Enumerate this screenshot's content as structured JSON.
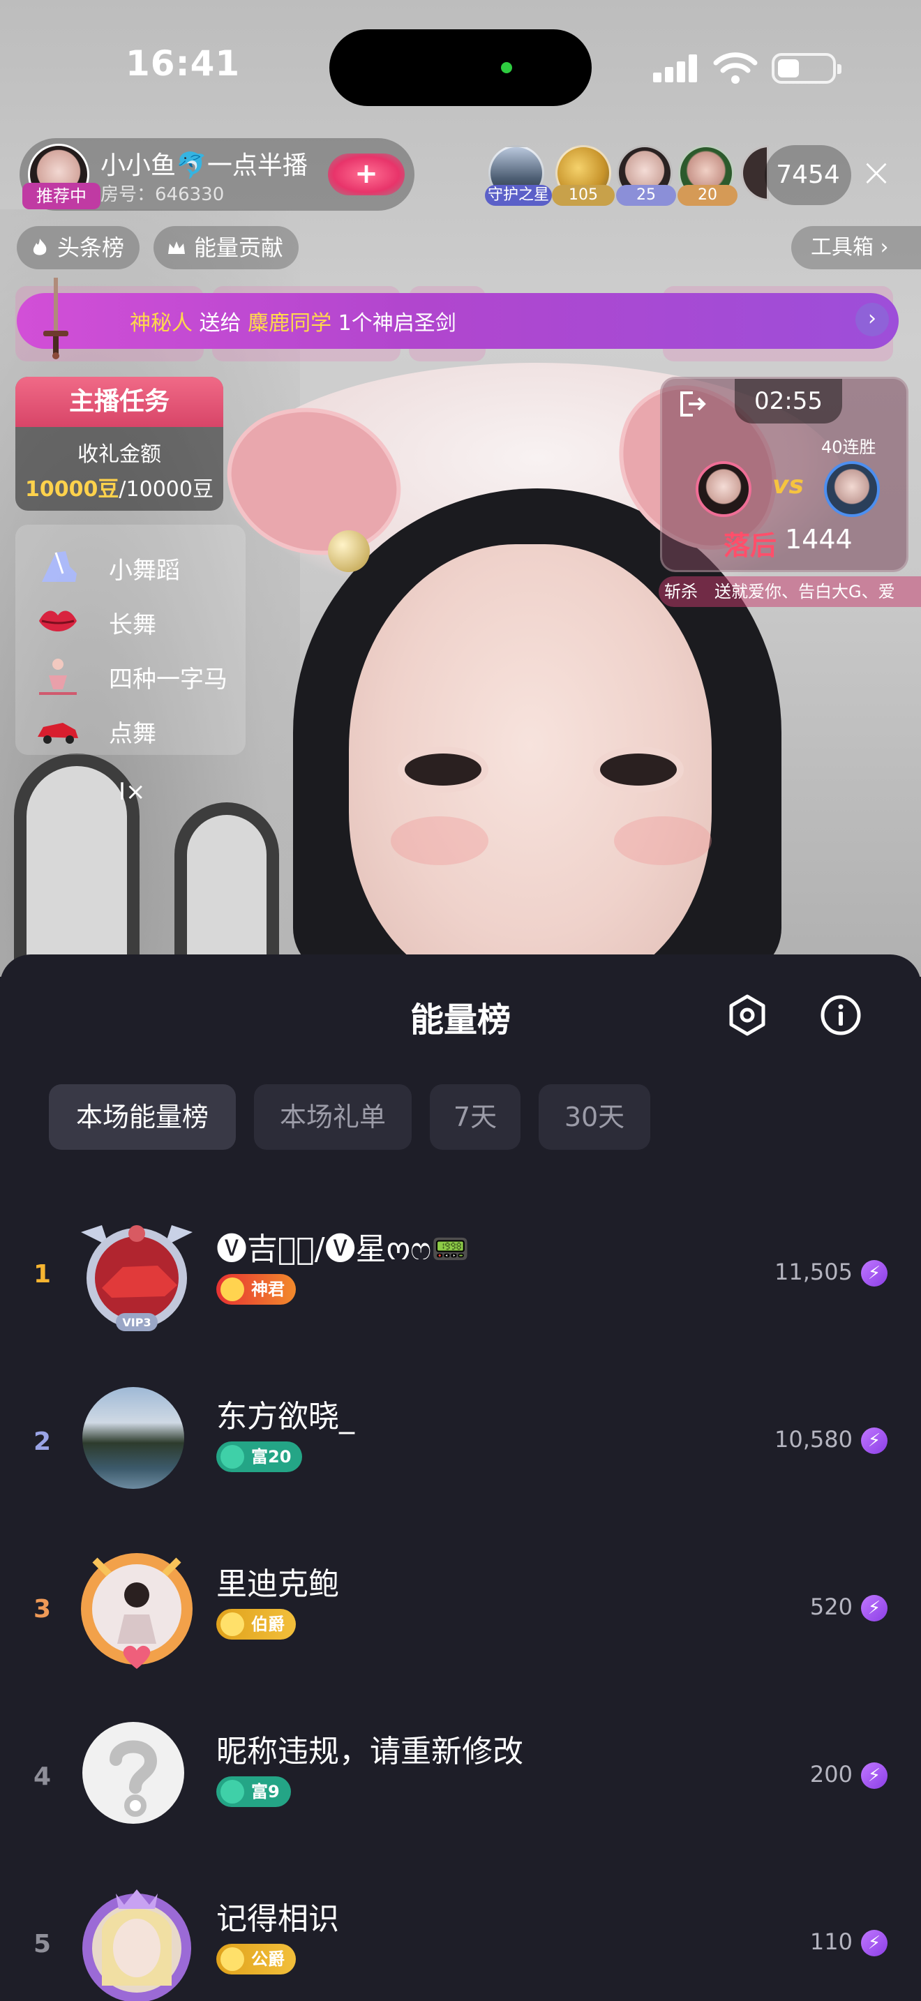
{
  "status_bar": {
    "time": "16:41"
  },
  "host": {
    "name": "小小鱼🐬一点半播",
    "room_label": "房号：646330",
    "recommend_badge": "推荐中",
    "follow_glyph": "+"
  },
  "viewers": {
    "tags": [
      "守护之星",
      "105",
      "25",
      "20"
    ],
    "count": "7454"
  },
  "chips": {
    "headline_board": "头条榜",
    "energy_contribution": "能量贡献",
    "toolbox": "工具箱"
  },
  "gift_banner": {
    "sender": "神秘人",
    "verb": "送给",
    "receiver": "麋鹿同学",
    "gift": "1个神启圣剑"
  },
  "task": {
    "title": "主播任务",
    "label": "收礼金额",
    "current": "10000豆",
    "target": "/10000豆"
  },
  "dance_menu": {
    "items": [
      "小舞蹈",
      "长舞",
      "四种一字马",
      "点舞"
    ]
  },
  "pk": {
    "timer": "02:55",
    "streak": "40连胜",
    "vs": "vs",
    "status": "落后",
    "score": "1444",
    "marquee": "斩杀　送就爱你、告白大G、爱"
  },
  "sheet": {
    "title": "能量榜",
    "tabs": [
      "本场能量榜",
      "本场礼单",
      "7天",
      "30天"
    ],
    "active_tab": 0,
    "rows": [
      {
        "rank": "1",
        "name": "🅥吉🥀⃠/🅥星ოෆ📟",
        "badge": "神君",
        "score": "11,505"
      },
      {
        "rank": "2",
        "name": "东方欲晓_",
        "badge": "富20",
        "score": "10,580"
      },
      {
        "rank": "3",
        "name": "里迪克鲍",
        "badge": "伯爵",
        "score": "520"
      },
      {
        "rank": "4",
        "name": "昵称违规，请重新修改",
        "badge": "富9",
        "score": "200"
      },
      {
        "rank": "5",
        "name": "记得相识",
        "badge": "公爵",
        "score": "110"
      }
    ]
  },
  "colors": {
    "sheet_bg": "#1e1e28",
    "rank_gold": "#f7b531",
    "rank_silver": "#9aa4e6",
    "rank_bronze": "#ef9a57",
    "energy_accent": "#a259f0",
    "pk_behind": "#ff4f6b"
  }
}
